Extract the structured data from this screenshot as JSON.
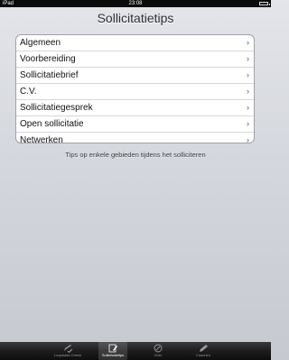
{
  "status_bar": {
    "carrier": "iPad",
    "time": "23:08"
  },
  "title": "Sollicitatietips",
  "menu": {
    "items": [
      {
        "label": "Algemeen"
      },
      {
        "label": "Voorbereiding"
      },
      {
        "label": "Sollicitatiebrief"
      },
      {
        "label": "C.V."
      },
      {
        "label": "Sollicitatiegesprek"
      },
      {
        "label": "Open sollicitatie"
      },
      {
        "label": "Netwerken"
      }
    ],
    "chevron": "›"
  },
  "footer_note": "Tips op enkele gebieden tijdens het solliciteren",
  "tab_bar": {
    "tabs": [
      {
        "label": "Loopbaan Check",
        "icon": "pencil-check-icon",
        "active": false
      },
      {
        "label": "Sollicitatietips",
        "icon": "pencil-pad-icon",
        "active": true
      },
      {
        "label": "Over",
        "icon": "info-icon",
        "active": false
      },
      {
        "label": "Coachen",
        "icon": "pencil-icon",
        "active": false
      }
    ]
  }
}
